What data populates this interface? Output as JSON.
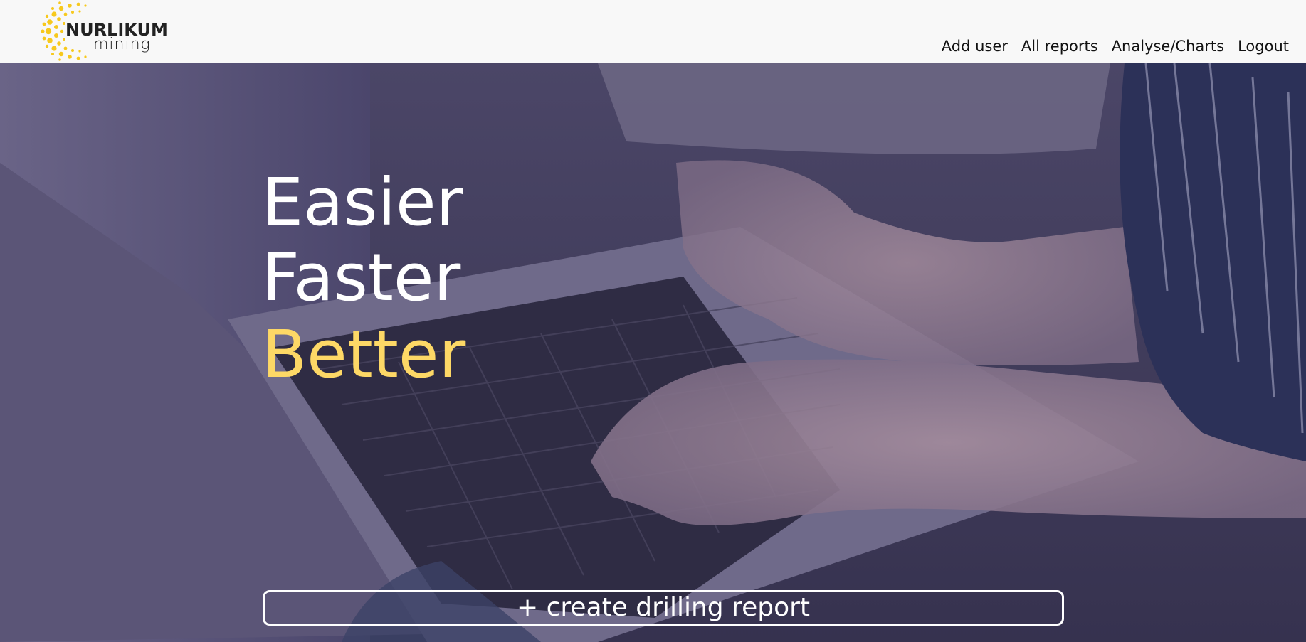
{
  "brand": {
    "name_line1": "NURLIKUM",
    "name_line2": "mining",
    "logo_icon": "sunburst-dots-icon",
    "accent_color": "#f7c91d"
  },
  "nav": {
    "items": [
      {
        "label": "Add user"
      },
      {
        "label": "All reports"
      },
      {
        "label": "Analyse/Charts"
      },
      {
        "label": "Logout"
      }
    ]
  },
  "hero": {
    "background": "photo-hands-typing-on-laptop",
    "overlay_color": "#3a3658",
    "headline": [
      "Easier",
      "Faster",
      "Better"
    ],
    "highlight_color": "#fdd866",
    "cta_label": "+ create drilling report"
  }
}
